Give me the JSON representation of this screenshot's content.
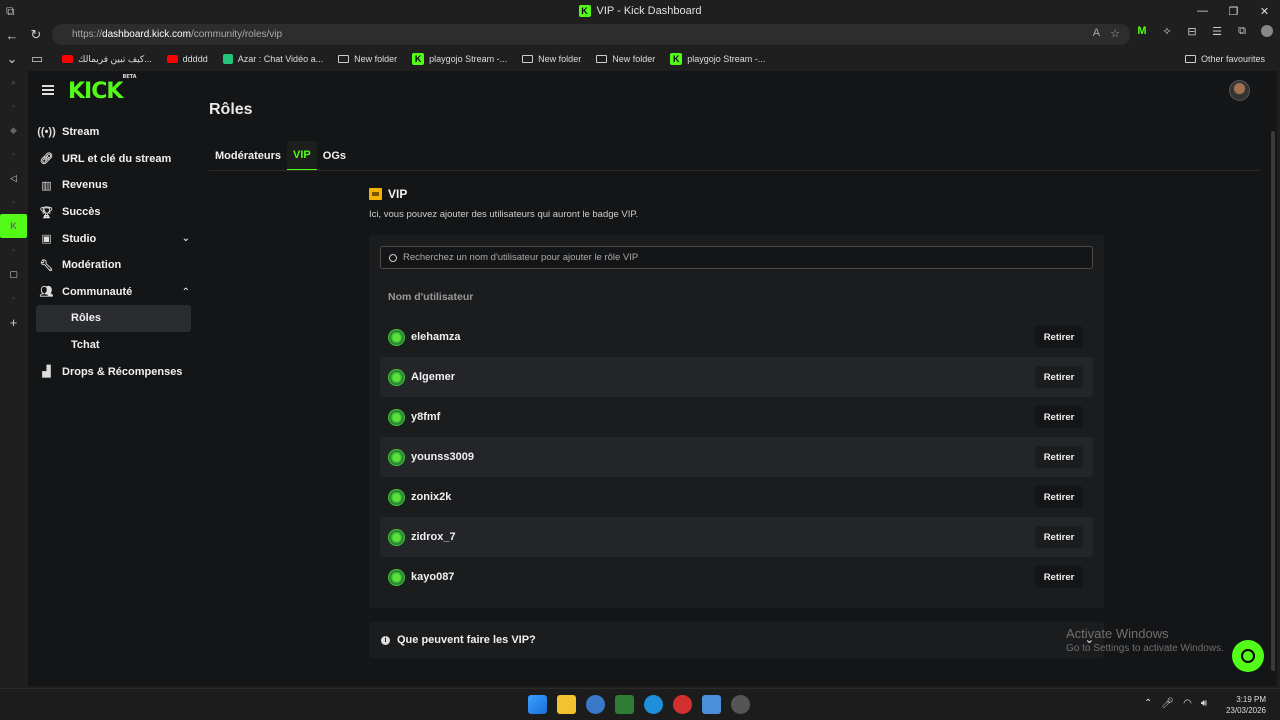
{
  "browser": {
    "window_title": "VIP - Kick Dashboard",
    "url_prefix": "https://",
    "url_host": "dashboard.kick.com",
    "url_path": "/community/roles/vip",
    "bookmarks": [
      {
        "label": "كيف تبين فريمالك...",
        "icon": "youtube-icon"
      },
      {
        "label": "ddddd",
        "icon": "youtube-icon"
      },
      {
        "label": "Azar : Chat Vidéo a...",
        "icon": "azar-icon"
      },
      {
        "label": "New folder",
        "icon": "folder-icon"
      },
      {
        "label": "playgojo Stream -...",
        "icon": "kick-icon"
      },
      {
        "label": "New folder",
        "icon": "folder-icon"
      },
      {
        "label": "New folder",
        "icon": "folder-icon"
      },
      {
        "label": "playgojo Stream -...",
        "icon": "kick-icon"
      }
    ],
    "other_favourites": "Other favourites"
  },
  "app": {
    "logo": "KICK",
    "logo_badge": "BETA"
  },
  "sidebar": {
    "items": [
      {
        "label": "Stream",
        "icon": "broadcast-icon"
      },
      {
        "label": "URL et clé du stream",
        "icon": "link-icon"
      },
      {
        "label": "Revenus",
        "icon": "chart-icon"
      },
      {
        "label": "Succès",
        "icon": "trophy-icon"
      },
      {
        "label": "Studio",
        "icon": "studio-icon"
      },
      {
        "label": "Modération",
        "icon": "wrench-icon"
      },
      {
        "label": "Communauté",
        "icon": "community-icon"
      }
    ],
    "sub_items": [
      {
        "label": "Rôles"
      },
      {
        "label": "Tchat"
      }
    ],
    "drops": {
      "label": "Drops & Récompenses",
      "icon": "drops-icon"
    }
  },
  "main": {
    "title": "Rôles",
    "tabs": [
      {
        "label": "Modérateurs"
      },
      {
        "label": "VIP"
      },
      {
        "label": "OGs"
      }
    ],
    "vip_title": "VIP",
    "vip_description": "Ici, vous pouvez ajouter des utilisateurs qui auront le badge VIP.",
    "search_placeholder": "Recherchez un nom d'utilisateur pour ajouter le rôle VIP",
    "column_header": "Nom d'utilisateur",
    "remove_label": "Retirer",
    "users": [
      {
        "name": "elehamza"
      },
      {
        "name": "Algemer"
      },
      {
        "name": "y8fmf"
      },
      {
        "name": "younss3009"
      },
      {
        "name": "zonix2k"
      },
      {
        "name": "zidrox_7"
      },
      {
        "name": "kayo087"
      }
    ],
    "faq_label": "Que peuvent faire les VIP?"
  },
  "watermark": {
    "line1": "Activate Windows",
    "line2": "Go to Settings to activate Windows."
  },
  "taskbar": {
    "time": "3:19 PM",
    "date": "23/03/2026"
  },
  "colors": {
    "accent": "#53fc18",
    "background": "#141517",
    "panel": "#1b1c1e"
  }
}
